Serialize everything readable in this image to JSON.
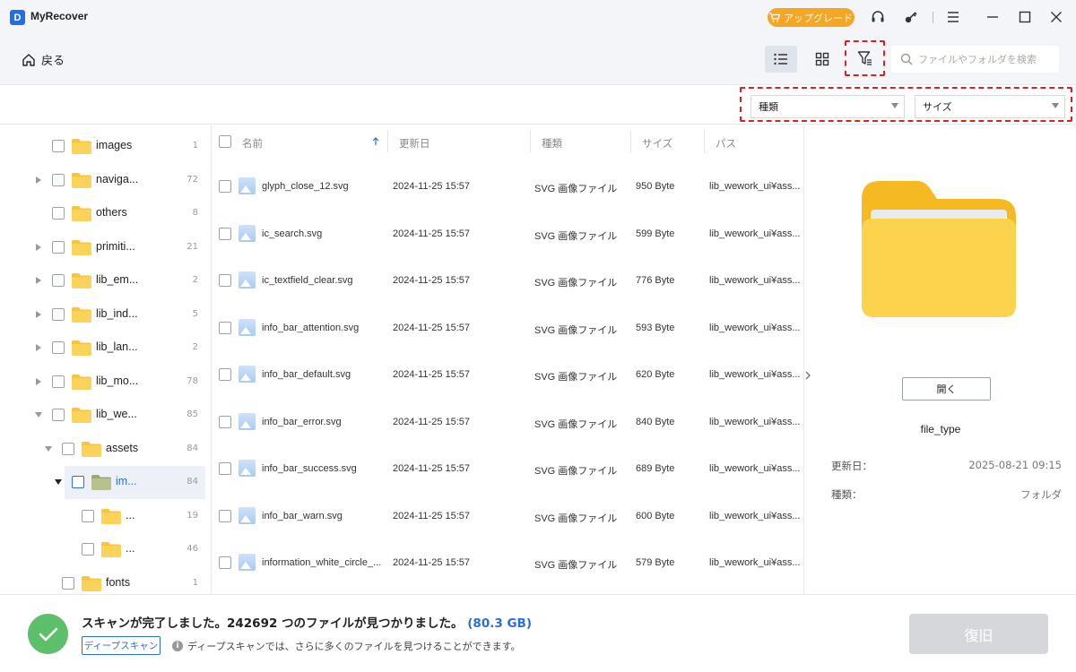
{
  "app": {
    "logo_letter": "D",
    "title": "MyRecover"
  },
  "titlebar": {
    "upgrade_label": "アップグレード"
  },
  "toolbar": {
    "back_label": "戻る",
    "search_placeholder": "ファイルやフォルダを検索"
  },
  "filters": {
    "type_label": "種類",
    "size_label": "サイズ"
  },
  "tree": [
    {
      "label": "images",
      "count": "1",
      "expand": "none",
      "level": 0
    },
    {
      "label": "naviga...",
      "count": "72",
      "expand": "collapsed",
      "level": 0
    },
    {
      "label": "others",
      "count": "8",
      "expand": "none",
      "level": 0
    },
    {
      "label": "primiti...",
      "count": "21",
      "expand": "collapsed",
      "level": 0
    },
    {
      "label": "lib_em...",
      "count": "2",
      "expand": "collapsed",
      "level": 0
    },
    {
      "label": "lib_ind...",
      "count": "5",
      "expand": "collapsed",
      "level": 0
    },
    {
      "label": "lib_lan...",
      "count": "2",
      "expand": "collapsed",
      "level": 0
    },
    {
      "label": "lib_mo...",
      "count": "78",
      "expand": "collapsed",
      "level": 0
    },
    {
      "label": "lib_we...",
      "count": "85",
      "expand": "expanded",
      "level": 0
    },
    {
      "label": "assets",
      "count": "84",
      "expand": "expanded",
      "level": 1
    },
    {
      "label": "im...",
      "count": "84",
      "expand": "expanded-dark",
      "level": 2,
      "selected": true
    },
    {
      "label": "...",
      "count": "19",
      "expand": "none",
      "level": 3
    },
    {
      "label": "...",
      "count": "46",
      "expand": "none",
      "level": 3
    },
    {
      "label": "fonts",
      "count": "1",
      "expand": "none",
      "level": 1
    }
  ],
  "list": {
    "columns": {
      "name": "名前",
      "modified": "更新日",
      "type": "種類",
      "size": "サイズ",
      "path": "パス"
    },
    "rows": [
      {
        "name": "glyph_close_12.svg",
        "modified": "2024-11-25 15:57",
        "type": "SVG 画像ファイル",
        "size": "950 Byte",
        "path": "lib_wework_ui¥ass..."
      },
      {
        "name": "ic_search.svg",
        "modified": "2024-11-25 15:57",
        "type": "SVG 画像ファイル",
        "size": "599 Byte",
        "path": "lib_wework_ui¥ass..."
      },
      {
        "name": "ic_textfield_clear.svg",
        "modified": "2024-11-25 15:57",
        "type": "SVG 画像ファイル",
        "size": "776 Byte",
        "path": "lib_wework_ui¥ass..."
      },
      {
        "name": "info_bar_attention.svg",
        "modified": "2024-11-25 15:57",
        "type": "SVG 画像ファイル",
        "size": "593 Byte",
        "path": "lib_wework_ui¥ass..."
      },
      {
        "name": "info_bar_default.svg",
        "modified": "2024-11-25 15:57",
        "type": "SVG 画像ファイル",
        "size": "620 Byte",
        "path": "lib_wework_ui¥ass..."
      },
      {
        "name": "info_bar_error.svg",
        "modified": "2024-11-25 15:57",
        "type": "SVG 画像ファイル",
        "size": "840 Byte",
        "path": "lib_wework_ui¥ass..."
      },
      {
        "name": "info_bar_success.svg",
        "modified": "2024-11-25 15:57",
        "type": "SVG 画像ファイル",
        "size": "689 Byte",
        "path": "lib_wework_ui¥ass..."
      },
      {
        "name": "info_bar_warn.svg",
        "modified": "2024-11-25 15:57",
        "type": "SVG 画像ファイル",
        "size": "600 Byte",
        "path": "lib_wework_ui¥ass..."
      },
      {
        "name": "information_white_circle_...",
        "modified": "2024-11-25 15:57",
        "type": "SVG 画像ファイル",
        "size": "579 Byte",
        "path": "lib_wework_ui¥ass..."
      }
    ]
  },
  "preview": {
    "open_label": "開く",
    "name": "file_type",
    "modified_label": "更新日：",
    "modified_value": "2025-08-21 09:15",
    "type_label": "種類：",
    "type_value": "フォルダ"
  },
  "bottom": {
    "scan_message": "スキャンが完了しました。242692 つのファイルが見つかりました。",
    "scan_size": "(80.3 GB)",
    "deep_scan_label": "ディープスキャン",
    "deep_scan_info": "ディープスキャンでは、さらに多くのファイルを見つけることができます。",
    "restore_label": "復旧"
  },
  "colors": {
    "accent": "#2a6fd6",
    "upgrade": "#f5a623",
    "success": "#5cbf6a",
    "highlight": "#e02020"
  }
}
